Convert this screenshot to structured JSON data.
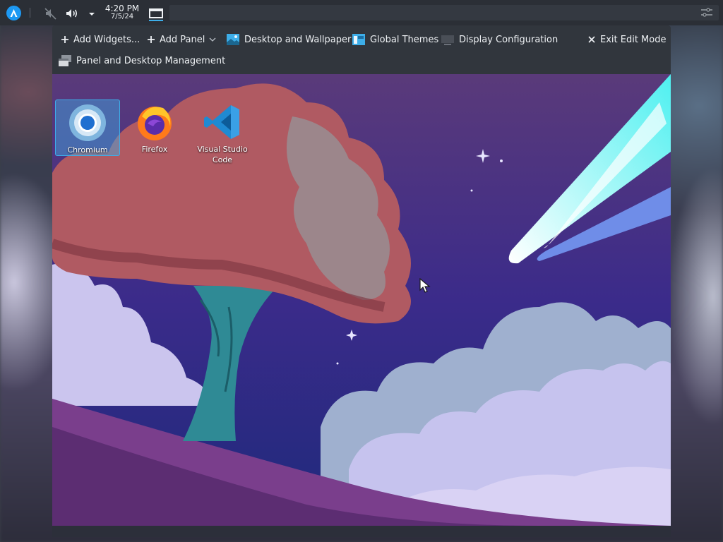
{
  "panel": {
    "clock_time": "4:20 PM",
    "clock_date": "7/5/24",
    "icons": [
      "app-launcher-icon",
      "mute-icon",
      "volume-icon",
      "chevron-down-icon",
      "show-desktop-icon",
      "panel-config-icon"
    ]
  },
  "toolbar": {
    "add_widgets": "Add Widgets...",
    "add_panel": "Add Panel",
    "desktop_wallpaper": "Desktop and Wallpaper",
    "global_themes": "Global Themes",
    "display_configuration": "Display Configuration",
    "exit_edit_mode": "Exit Edit Mode",
    "panel_desktop_management": "Panel and Desktop Management"
  },
  "desktop": {
    "icons": [
      {
        "label": "Chromium",
        "selected": true
      },
      {
        "label": "Firefox",
        "selected": false
      },
      {
        "label": "Visual Studio Code",
        "selected": false
      }
    ]
  },
  "colors": {
    "accent": "#3daee9",
    "panel_bg": "#2b2f36",
    "toolbar_bg": "#31363d"
  }
}
